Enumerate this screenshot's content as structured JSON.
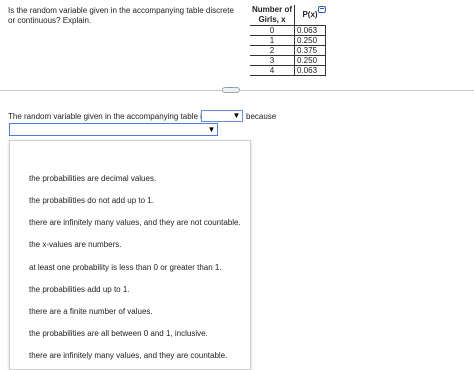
{
  "question": "Is the random variable given in the accompanying table discrete or continuous? Explain.",
  "table": {
    "headers": [
      "Number of Girls, x",
      "P(x)"
    ],
    "rows": [
      [
        "0",
        "0.063"
      ],
      [
        "1",
        "0.250"
      ],
      [
        "2",
        "0.375"
      ],
      [
        "3",
        "0.250"
      ],
      [
        "4",
        "0.063"
      ]
    ]
  },
  "copy_icon": "copy-icon",
  "divider_handle": "...",
  "answer": {
    "prefix": "The random variable given in the accompanying table is",
    "select_value": "",
    "arrow": "▼",
    "suffix": "because",
    "reason_value": ""
  },
  "dropdown_options": [
    "the probabilities are decimal values.",
    "the probabilities do not add up to 1.",
    "there are infinitely many values, and they are not countable.",
    "the x-values are numbers.",
    "at least one probability is less than 0 or greater than 1.",
    "the probabilities add up to 1.",
    "there are a finite number of values.",
    "the probabilities are all between 0 and 1, inclusive.",
    "there are infinitely many values, and they are countable."
  ]
}
